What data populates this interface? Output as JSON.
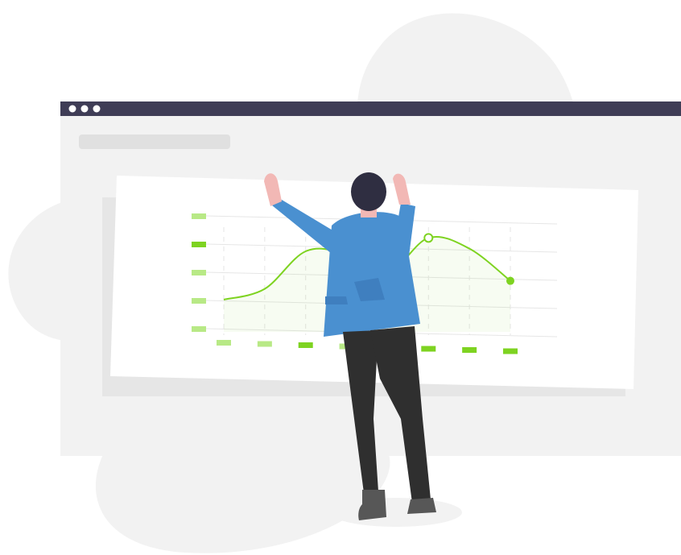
{
  "illustration": {
    "title_bar_dots": 3,
    "colors": {
      "blob": "#f2f2f2",
      "window_bg": "#f2f2f2",
      "window_bar": "#3f3d56",
      "window_bar_dark": "#2f2e41",
      "placeholder_bar": "#e0e0e0",
      "card_shadow": "#e6e6e6",
      "card": "#ffffff",
      "accent": "#7ed321",
      "accent_light": "#b8e986",
      "grid": "#e6e6e6",
      "jacket": "#4a90d0",
      "jacket_dark": "#3f7fbf",
      "hair": "#2f2e41",
      "skin": "#f2b8b5",
      "pants": "#2f2f2f",
      "shoes": "#575757"
    },
    "icons": [
      "dots-icon",
      "chart-line-icon",
      "person-figure-icon"
    ]
  },
  "chart_data": {
    "type": "line",
    "title": "",
    "xlabel": "",
    "ylabel": "",
    "categories": [
      "",
      "",
      "",
      "",
      "",
      "",
      "",
      ""
    ],
    "series": [
      {
        "values": [
          1.2,
          1.6,
          3.0,
          2.9,
          2.2,
          3.5,
          3.1,
          1.9
        ]
      }
    ],
    "ylim": [
      0,
      4.5
    ],
    "grid": true
  }
}
